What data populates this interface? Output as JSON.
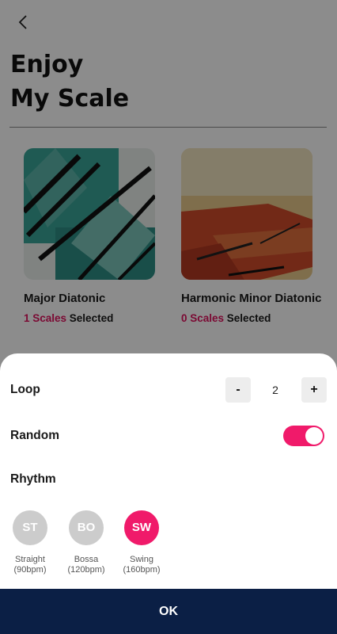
{
  "header": {
    "back_icon": "chevron-left-icon",
    "title_line1": "Enjoy",
    "title_line2": "My Scale"
  },
  "cards": [
    {
      "name": "Major Diatonic",
      "count": "1 Scales",
      "suffix": " Selected",
      "colors": {
        "primary": "#2f9a8f",
        "accent": "#111111"
      }
    },
    {
      "name": "Harmonic Minor Diatonic",
      "count": "0 Scales",
      "suffix": " Selected",
      "colors": {
        "primary": "#d14a2a",
        "accent": "#e7c27a"
      }
    }
  ],
  "sheet": {
    "loop": {
      "label": "Loop",
      "minus": "-",
      "value": "2",
      "plus": "+"
    },
    "random": {
      "label": "Random",
      "on": true
    },
    "rhythm": {
      "label": "Rhythm",
      "options": [
        {
          "abbr": "ST",
          "name": "Straight",
          "bpm": "(90bpm)",
          "active": false
        },
        {
          "abbr": "BO",
          "name": "Bossa",
          "bpm": "(120bpm)",
          "active": false
        },
        {
          "abbr": "SW",
          "name": "Swing",
          "bpm": "(160bpm)",
          "active": true
        }
      ]
    },
    "ok_label": "OK"
  },
  "colors": {
    "accent": "#f01a6a",
    "count_text": "#e0125e",
    "ok_bar": "#0b1f45"
  }
}
